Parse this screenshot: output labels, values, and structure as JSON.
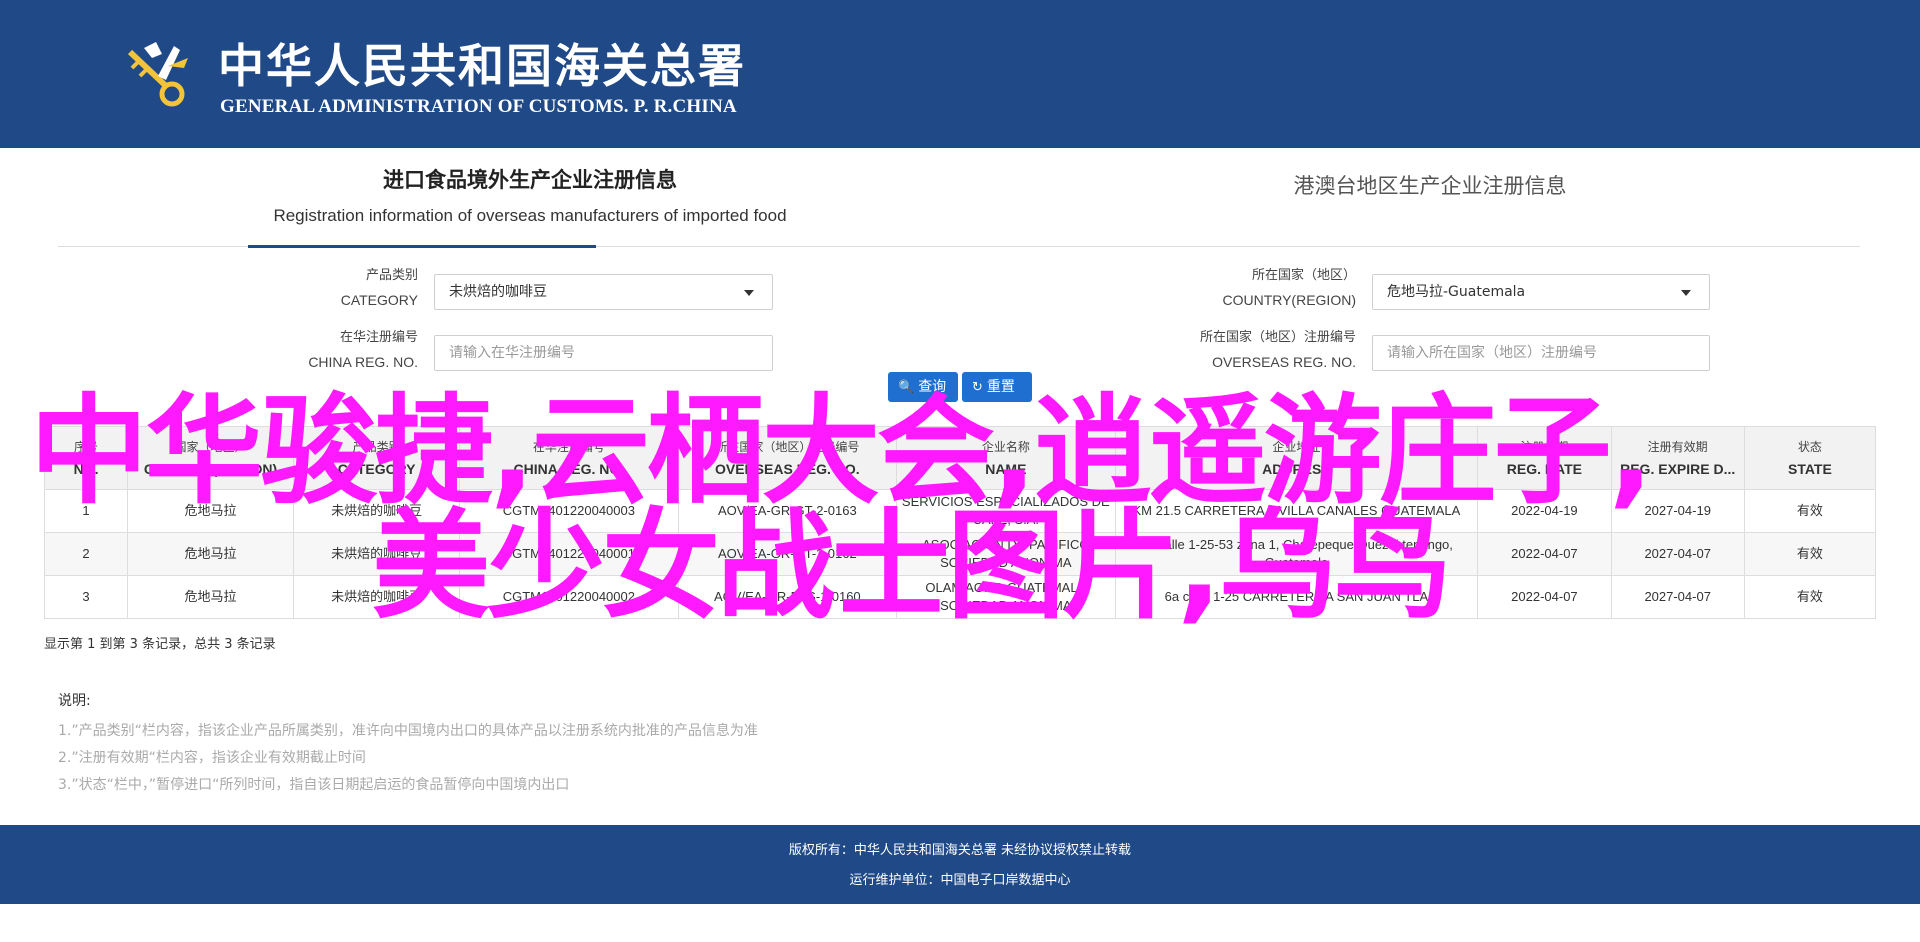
{
  "header": {
    "title_cn": "中华人民共和国海关总署",
    "title_en": "GENERAL ADMINISTRATION OF CUSTOMS. P. R.CHINA",
    "emblem": "customs-emblem-icon",
    "bg_color": "#1f4987"
  },
  "tabs": {
    "active_cn": "进口食品境外生产企业注册信息",
    "active_en": "Registration information of overseas manufacturers of imported food",
    "other_cn": "港澳台地区生产企业注册信息"
  },
  "filters": {
    "category_label_cn": "产品类别",
    "category_label_en": "CATEGORY",
    "category_value": "未烘焙的咖啡豆",
    "country_label_cn": "所在国家（地区）",
    "country_label_en": "COUNTRY(REGION)",
    "country_value": "危地马拉-Guatemala",
    "china_reg_label_cn": "在华注册编号",
    "china_reg_label_en": "CHINA REG. NO.",
    "china_reg_placeholder": "请输入在华注册编号",
    "overseas_reg_label_cn": "所在国家（地区）注册编号",
    "overseas_reg_label_en": "OVERSEAS REG. NO.",
    "overseas_reg_placeholder": "请输入所在国家（地区）注册编号",
    "search_label": "查询",
    "reset_label": "重置"
  },
  "table": {
    "headers": [
      {
        "cn": "序号",
        "en": "NO."
      },
      {
        "cn": "国家（地区）",
        "en": "COUNTRY(REGION)"
      },
      {
        "cn": "产品类别",
        "en": "CATEGORY"
      },
      {
        "cn": "在华注册编号",
        "en": "CHINA REG. NO."
      },
      {
        "cn": "所在国家（地区）注册编号",
        "en": "OVERSEAS REG. NO."
      },
      {
        "cn": "企业名称",
        "en": "NAME"
      },
      {
        "cn": "企业地址",
        "en": "ADDRESS"
      },
      {
        "cn": "注册日期",
        "en": "REG. DATE"
      },
      {
        "cn": "注册有效期",
        "en": "REG. EXPIRE D..."
      },
      {
        "cn": "状态",
        "en": "STATE"
      }
    ],
    "rows": [
      [
        "1",
        "危地马拉",
        "未烘焙的咖啡豆",
        "CGTM1401220040003",
        "AOV/EA-GR-GT-2-0163",
        "SERVICIOS ESPECIALIZADOS DE CAFE, S.A.",
        "KM 21.5 CARRETERA A VILLA CANALES GUATEMALA",
        "2022-04-19",
        "2027-04-19",
        "有效"
      ],
      [
        "2",
        "危地马拉",
        "未烘焙的咖啡豆",
        "CGTM1401220040001",
        "AOV/EA-GR-GT-2-0162",
        "ASOCIACION DE PACIFICO SOCIEDAD ANONIMA",
        "6a calle 1-25-53 zona 1, Chatepeque Quezal tenango, Guatemala",
        "2022-04-07",
        "2027-04-07",
        "有效"
      ],
      [
        "3",
        "危地马拉",
        "未烘焙的咖啡豆",
        "CGTM1401220040002",
        "AOV/EA-GR-FES-1-0160",
        "OLAM AGRO GUATEMALA SOCIEDAD ANONIMA",
        "6a calle 1-25 CARRETERA A SAN JUAN TLA",
        "2022-04-07",
        "2027-04-07",
        "有效"
      ]
    ]
  },
  "pager_info": "显示第 1 到第 3 条记录，总共 3 条记录",
  "notes": {
    "title": "说明:",
    "lines": [
      "1.”产品类别“栏内容，指该企业产品所属类别，准许向中国境内出口的具体产品以注册系统内批准的产品信息为准",
      "2.”注册有效期“栏内容，指该企业有效期截止时间",
      "3.”状态“栏中，”暂停进口“所列时间，指自该日期起启运的食品暂停向中国境内出口"
    ]
  },
  "footer": {
    "line1": "版权所有：中华人民共和国海关总署 未经协议授权禁止转载",
    "line2": "运行维护单位：中国电子口岸数据中心"
  },
  "overlay": {
    "line1": "中华骏捷,云栖大会,逍遥游庄子,",
    "line2": "美少女战士图片,乌鸟",
    "color": "#ff19ff"
  }
}
